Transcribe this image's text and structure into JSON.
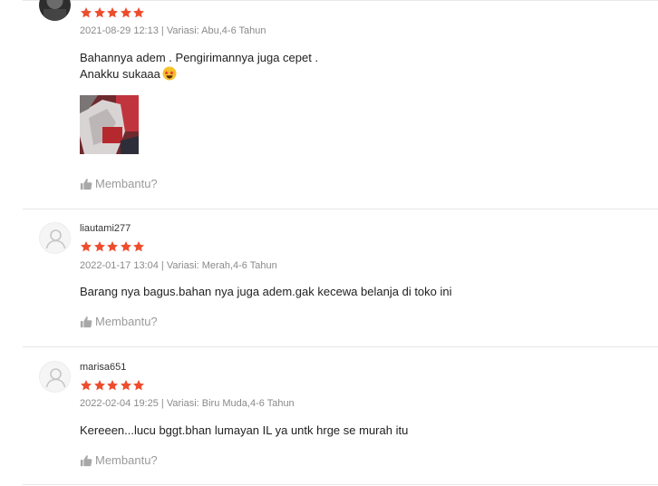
{
  "colors": {
    "star": "#ee4d2d",
    "meta": "#8a8a8a",
    "helpful": "#9a9a9a",
    "divider": "#e8e8e8"
  },
  "reviews": [
    {
      "username": "",
      "rating": 5,
      "timestamp": "2021-08-29 12:13",
      "variation": "Variasi: Abu,4-6 Tahun",
      "content_lines": [
        "Bahannya adem . Pengirimannya juga cepet .",
        "Anakku sukaaa"
      ],
      "emoji": "star-struck-emoji",
      "has_photo": true,
      "helpful_label": "Membantu?"
    },
    {
      "username": "liautami277",
      "rating": 5,
      "timestamp": "2022-01-17 13:04",
      "variation": "Variasi: Merah,4-6 Tahun",
      "content_lines": [
        "Barang nya bagus.bahan nya juga adem.gak kecewa belanja di toko ini"
      ],
      "helpful_label": "Membantu?"
    },
    {
      "username": "marisa651",
      "rating": 5,
      "timestamp": "2022-02-04 19:25",
      "variation": "Variasi: Biru Muda,4-6 Tahun",
      "content_lines": [
        "Kereeen...lucu bggt.bhan lumayan IL ya untk hrge se murah itu"
      ],
      "helpful_label": "Membantu?"
    }
  ]
}
